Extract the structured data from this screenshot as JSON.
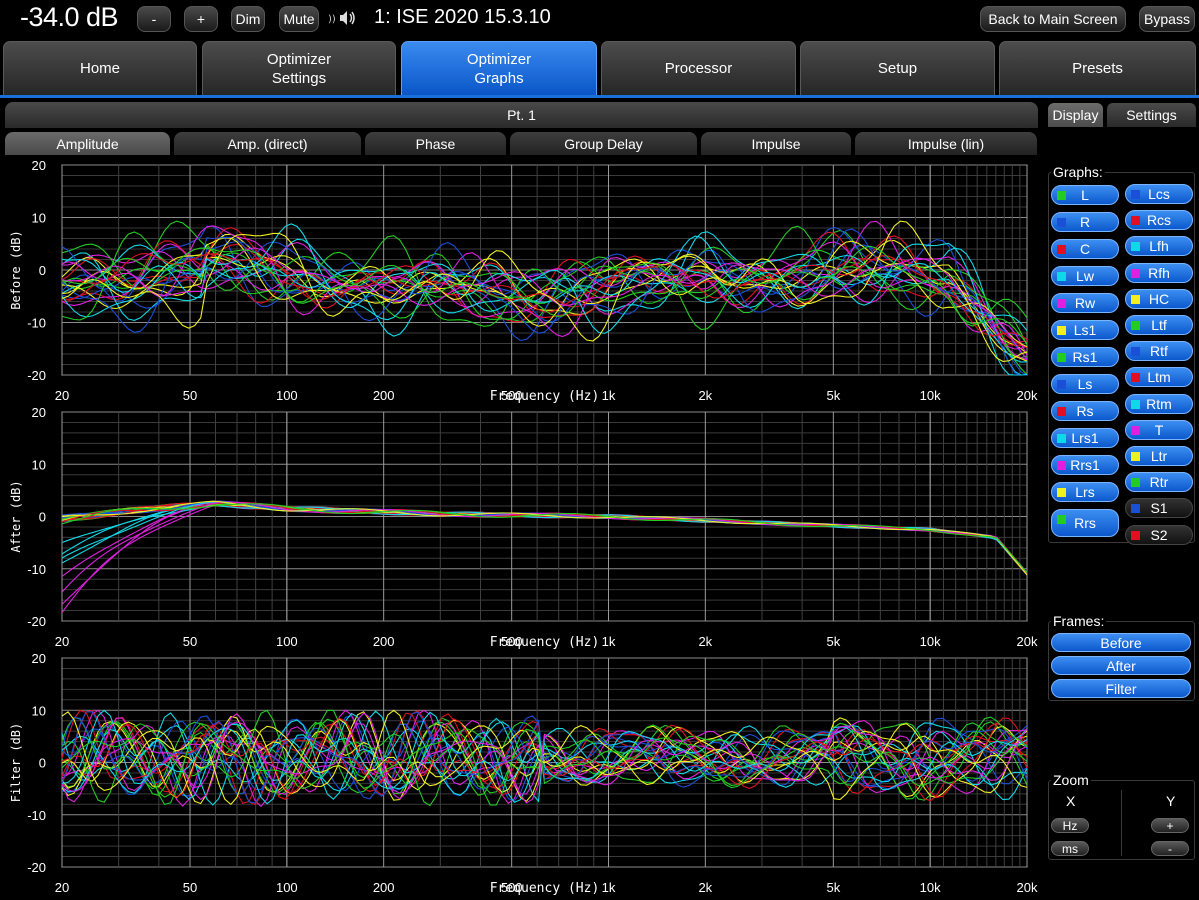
{
  "topbar": {
    "volume": "-34.0 dB",
    "minus_label": "-",
    "plus_label": "+",
    "dim_label": "Dim",
    "mute_label": "Mute",
    "speaker_icon": "speaker-wave-icon",
    "title": "1: ISE 2020 15.3.10",
    "back_label": "Back to Main Screen",
    "bypass_label": "Bypass"
  },
  "nav": {
    "tabs": [
      {
        "label": "Home"
      },
      {
        "label": "Optimizer\nSettings"
      },
      {
        "label": "Optimizer\nGraphs",
        "active": true
      },
      {
        "label": "Processor"
      },
      {
        "label": "Setup"
      },
      {
        "label": "Presets"
      }
    ],
    "accent": "#1b6fd8"
  },
  "main": {
    "point_label": "Pt. 1",
    "graph_tabs": [
      "Amplitude",
      "Amp. (direct)",
      "Phase",
      "Group Delay",
      "Impulse",
      "Impulse (lin)"
    ],
    "active_graph_tab": "Amplitude"
  },
  "sidebar": {
    "tabs": [
      "Display",
      "Settings"
    ],
    "graphs_label": "Graphs:",
    "channels_left": [
      {
        "name": "L",
        "color": "#22cc22",
        "on": true
      },
      {
        "name": "R",
        "color": "#1a4fd8",
        "on": true
      },
      {
        "name": "C",
        "color": "#e01020",
        "on": true
      },
      {
        "name": "Lw",
        "color": "#10d8e8",
        "on": true
      },
      {
        "name": "Rw",
        "color": "#e020e0",
        "on": true
      },
      {
        "name": "Ls1",
        "color": "#f0f020",
        "on": true
      },
      {
        "name": "Rs1",
        "color": "#22cc22",
        "on": true
      },
      {
        "name": "Ls",
        "color": "#1a4fd8",
        "on": true
      },
      {
        "name": "Rs",
        "color": "#e01020",
        "on": true
      },
      {
        "name": "Lrs1",
        "color": "#10d8e8",
        "on": true
      },
      {
        "name": "Rrs1",
        "color": "#e020e0",
        "on": true
      },
      {
        "name": "Lrs",
        "color": "#f0f020",
        "on": true
      },
      {
        "name": "Rrs",
        "color": "#22cc22",
        "on": true
      }
    ],
    "channels_right": [
      {
        "name": "Lcs",
        "color": "#1a4fd8",
        "on": true
      },
      {
        "name": "Rcs",
        "color": "#e01020",
        "on": true
      },
      {
        "name": "Lfh",
        "color": "#10d8e8",
        "on": true
      },
      {
        "name": "Rfh",
        "color": "#e020e0",
        "on": true
      },
      {
        "name": "HC",
        "color": "#f0f020",
        "on": true
      },
      {
        "name": "Ltf",
        "color": "#22cc22",
        "on": true
      },
      {
        "name": "Rtf",
        "color": "#1a4fd8",
        "on": true
      },
      {
        "name": "Ltm",
        "color": "#e01020",
        "on": true
      },
      {
        "name": "Rtm",
        "color": "#10d8e8",
        "on": true
      },
      {
        "name": "T",
        "color": "#e020e0",
        "on": true
      },
      {
        "name": "Ltr",
        "color": "#f0f020",
        "on": true
      },
      {
        "name": "Rtr",
        "color": "#22cc22",
        "on": true
      },
      {
        "name": "S1",
        "color": "#1a4fd8",
        "on": false
      },
      {
        "name": "S2",
        "color": "#e01020",
        "on": false
      }
    ],
    "frames_label": "Frames:",
    "frames": [
      "Before",
      "After",
      "Filter"
    ],
    "zoom_label": "Zoom",
    "zoom_x_label": "X",
    "zoom_y_label": "Y",
    "zoom_hz": "Hz",
    "zoom_ms": "ms",
    "zoom_plus": "+",
    "zoom_minus": "-"
  },
  "chart_data": [
    {
      "type": "line",
      "name": "before",
      "ylabel": "Before (dB)",
      "xlabel": "Frequency (Hz)",
      "x_scale": "log",
      "xlim": [
        20,
        20000
      ],
      "ylim": [
        -20,
        20
      ],
      "x_ticks": [
        20,
        50,
        100,
        200,
        500,
        1000,
        2000,
        5000,
        10000,
        20000
      ],
      "x_tick_labels": [
        "20",
        "50",
        "100",
        "200",
        "500",
        "1k",
        "2k",
        "5k",
        "10k",
        "20k"
      ],
      "y_ticks": [
        -20,
        -10,
        0,
        10,
        20
      ],
      "y_tick_labels": [
        "-20",
        "-10",
        "0",
        "10",
        "20"
      ],
      "grid": true,
      "trace_count": 25,
      "envelope": {
        "x": [
          20,
          35,
          70,
          150,
          400,
          700,
          2000,
          5000,
          10000,
          16000,
          20000
        ],
        "min": [
          -14,
          -16,
          -3,
          -8,
          -9,
          -8,
          -9,
          -10,
          -8,
          -10,
          -20
        ],
        "max": [
          3,
          5,
          8,
          6,
          5,
          7,
          3,
          0,
          1,
          0,
          -6
        ]
      }
    },
    {
      "type": "line",
      "name": "after",
      "ylabel": "After (dB)",
      "xlabel": "Frequency (Hz)",
      "x_scale": "log",
      "xlim": [
        20,
        20000
      ],
      "ylim": [
        -20,
        20
      ],
      "x_ticks": [
        20,
        50,
        100,
        200,
        500,
        1000,
        2000,
        5000,
        10000,
        20000
      ],
      "x_tick_labels": [
        "20",
        "50",
        "100",
        "200",
        "500",
        "1k",
        "2k",
        "5k",
        "10k",
        "20k"
      ],
      "y_ticks": [
        -20,
        -10,
        0,
        10,
        20
      ],
      "y_tick_labels": [
        "-20",
        "-10",
        "0",
        "10",
        "20"
      ],
      "grid": true,
      "trace_count": 25,
      "target_curve": {
        "x": [
          20,
          60,
          100,
          300,
          1000,
          3000,
          10000,
          16000,
          20000
        ],
        "y": [
          1,
          2.5,
          1.5,
          0.5,
          0,
          -1.2,
          -2.5,
          -4,
          -11
        ]
      }
    },
    {
      "type": "line",
      "name": "filter",
      "ylabel": "Filter (dB)",
      "xlabel": "Frequency (Hz)",
      "x_scale": "log",
      "xlim": [
        20,
        20000
      ],
      "ylim": [
        -20,
        20
      ],
      "x_ticks": [
        20,
        50,
        100,
        200,
        500,
        1000,
        2000,
        5000,
        10000,
        20000
      ],
      "x_tick_labels": [
        "20",
        "50",
        "100",
        "200",
        "500",
        "1k",
        "2k",
        "5k",
        "10k",
        "20k"
      ],
      "y_ticks": [
        -20,
        -10,
        0,
        10,
        20
      ],
      "y_tick_labels": [
        "-20",
        "-10",
        "0",
        "10",
        "20"
      ],
      "grid": true,
      "trace_count": 25,
      "range": [
        -10,
        10
      ]
    }
  ]
}
